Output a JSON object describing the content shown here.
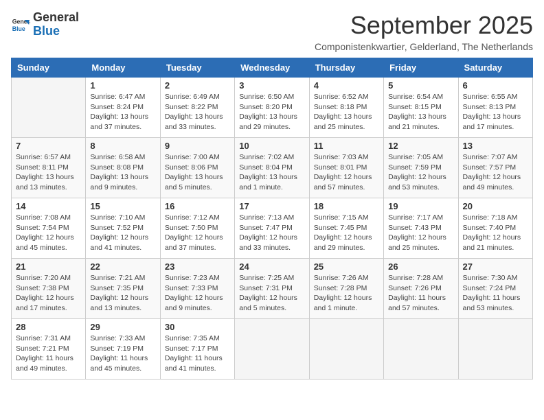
{
  "header": {
    "logo": {
      "general": "General",
      "blue": "Blue"
    },
    "title": "September 2025",
    "subtitle": "Componistenkwartier, Gelderland, The Netherlands"
  },
  "weekdays": [
    "Sunday",
    "Monday",
    "Tuesday",
    "Wednesday",
    "Thursday",
    "Friday",
    "Saturday"
  ],
  "weeks": [
    [
      {
        "day": "",
        "info": ""
      },
      {
        "day": "1",
        "info": "Sunrise: 6:47 AM\nSunset: 8:24 PM\nDaylight: 13 hours and 37 minutes."
      },
      {
        "day": "2",
        "info": "Sunrise: 6:49 AM\nSunset: 8:22 PM\nDaylight: 13 hours and 33 minutes."
      },
      {
        "day": "3",
        "info": "Sunrise: 6:50 AM\nSunset: 8:20 PM\nDaylight: 13 hours and 29 minutes."
      },
      {
        "day": "4",
        "info": "Sunrise: 6:52 AM\nSunset: 8:18 PM\nDaylight: 13 hours and 25 minutes."
      },
      {
        "day": "5",
        "info": "Sunrise: 6:54 AM\nSunset: 8:15 PM\nDaylight: 13 hours and 21 minutes."
      },
      {
        "day": "6",
        "info": "Sunrise: 6:55 AM\nSunset: 8:13 PM\nDaylight: 13 hours and 17 minutes."
      }
    ],
    [
      {
        "day": "7",
        "info": "Sunrise: 6:57 AM\nSunset: 8:11 PM\nDaylight: 13 hours and 13 minutes."
      },
      {
        "day": "8",
        "info": "Sunrise: 6:58 AM\nSunset: 8:08 PM\nDaylight: 13 hours and 9 minutes."
      },
      {
        "day": "9",
        "info": "Sunrise: 7:00 AM\nSunset: 8:06 PM\nDaylight: 13 hours and 5 minutes."
      },
      {
        "day": "10",
        "info": "Sunrise: 7:02 AM\nSunset: 8:04 PM\nDaylight: 13 hours and 1 minute."
      },
      {
        "day": "11",
        "info": "Sunrise: 7:03 AM\nSunset: 8:01 PM\nDaylight: 12 hours and 57 minutes."
      },
      {
        "day": "12",
        "info": "Sunrise: 7:05 AM\nSunset: 7:59 PM\nDaylight: 12 hours and 53 minutes."
      },
      {
        "day": "13",
        "info": "Sunrise: 7:07 AM\nSunset: 7:57 PM\nDaylight: 12 hours and 49 minutes."
      }
    ],
    [
      {
        "day": "14",
        "info": "Sunrise: 7:08 AM\nSunset: 7:54 PM\nDaylight: 12 hours and 45 minutes."
      },
      {
        "day": "15",
        "info": "Sunrise: 7:10 AM\nSunset: 7:52 PM\nDaylight: 12 hours and 41 minutes."
      },
      {
        "day": "16",
        "info": "Sunrise: 7:12 AM\nSunset: 7:50 PM\nDaylight: 12 hours and 37 minutes."
      },
      {
        "day": "17",
        "info": "Sunrise: 7:13 AM\nSunset: 7:47 PM\nDaylight: 12 hours and 33 minutes."
      },
      {
        "day": "18",
        "info": "Sunrise: 7:15 AM\nSunset: 7:45 PM\nDaylight: 12 hours and 29 minutes."
      },
      {
        "day": "19",
        "info": "Sunrise: 7:17 AM\nSunset: 7:43 PM\nDaylight: 12 hours and 25 minutes."
      },
      {
        "day": "20",
        "info": "Sunrise: 7:18 AM\nSunset: 7:40 PM\nDaylight: 12 hours and 21 minutes."
      }
    ],
    [
      {
        "day": "21",
        "info": "Sunrise: 7:20 AM\nSunset: 7:38 PM\nDaylight: 12 hours and 17 minutes."
      },
      {
        "day": "22",
        "info": "Sunrise: 7:21 AM\nSunset: 7:35 PM\nDaylight: 12 hours and 13 minutes."
      },
      {
        "day": "23",
        "info": "Sunrise: 7:23 AM\nSunset: 7:33 PM\nDaylight: 12 hours and 9 minutes."
      },
      {
        "day": "24",
        "info": "Sunrise: 7:25 AM\nSunset: 7:31 PM\nDaylight: 12 hours and 5 minutes."
      },
      {
        "day": "25",
        "info": "Sunrise: 7:26 AM\nSunset: 7:28 PM\nDaylight: 12 hours and 1 minute."
      },
      {
        "day": "26",
        "info": "Sunrise: 7:28 AM\nSunset: 7:26 PM\nDaylight: 11 hours and 57 minutes."
      },
      {
        "day": "27",
        "info": "Sunrise: 7:30 AM\nSunset: 7:24 PM\nDaylight: 11 hours and 53 minutes."
      }
    ],
    [
      {
        "day": "28",
        "info": "Sunrise: 7:31 AM\nSunset: 7:21 PM\nDaylight: 11 hours and 49 minutes."
      },
      {
        "day": "29",
        "info": "Sunrise: 7:33 AM\nSunset: 7:19 PM\nDaylight: 11 hours and 45 minutes."
      },
      {
        "day": "30",
        "info": "Sunrise: 7:35 AM\nSunset: 7:17 PM\nDaylight: 11 hours and 41 minutes."
      },
      {
        "day": "",
        "info": ""
      },
      {
        "day": "",
        "info": ""
      },
      {
        "day": "",
        "info": ""
      },
      {
        "day": "",
        "info": ""
      }
    ]
  ]
}
